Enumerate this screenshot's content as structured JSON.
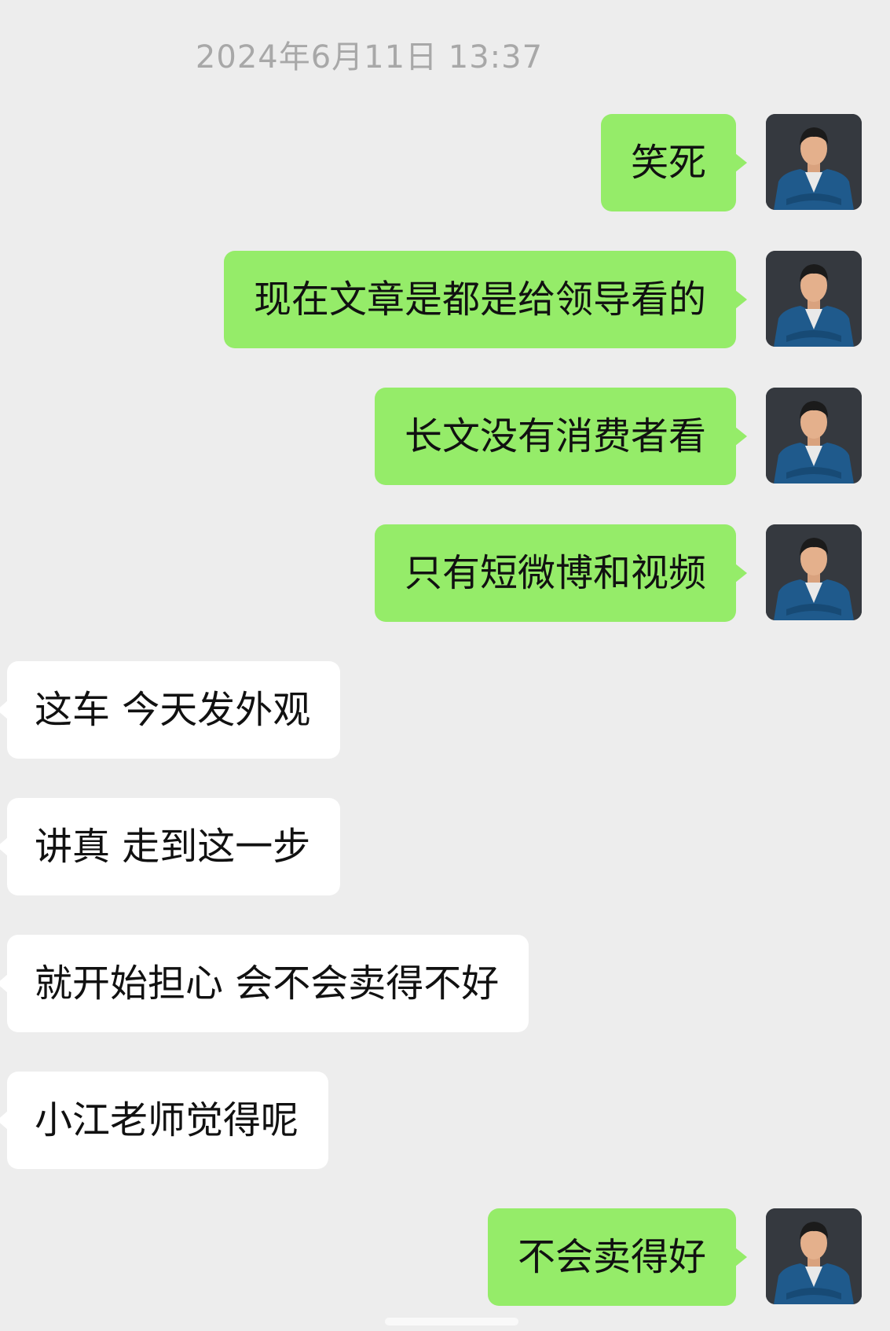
{
  "chat": {
    "timestamp": "2024年6月11日 13:37",
    "messages": [
      {
        "direction": "sent",
        "text": "笑死"
      },
      {
        "direction": "sent",
        "text": "现在文章是都是给领导看的"
      },
      {
        "direction": "sent",
        "text": "长文没有消费者看"
      },
      {
        "direction": "sent",
        "text": "只有短微博和视频"
      },
      {
        "direction": "received",
        "text": "这车 今天发外观"
      },
      {
        "direction": "received",
        "text": "讲真 走到这一步"
      },
      {
        "direction": "received",
        "text": "就开始担心 会不会卖得不好"
      },
      {
        "direction": "received",
        "text": "小江老师觉得呢"
      },
      {
        "direction": "sent",
        "text": "不会卖得好"
      }
    ]
  },
  "colors": {
    "background": "#ededed",
    "sent_bubble": "#95ec69",
    "received_bubble": "#ffffff",
    "timestamp_text": "#a8a8a8",
    "message_text": "#111111"
  },
  "icons": {
    "sent_avatar": "user-avatar-photo"
  }
}
